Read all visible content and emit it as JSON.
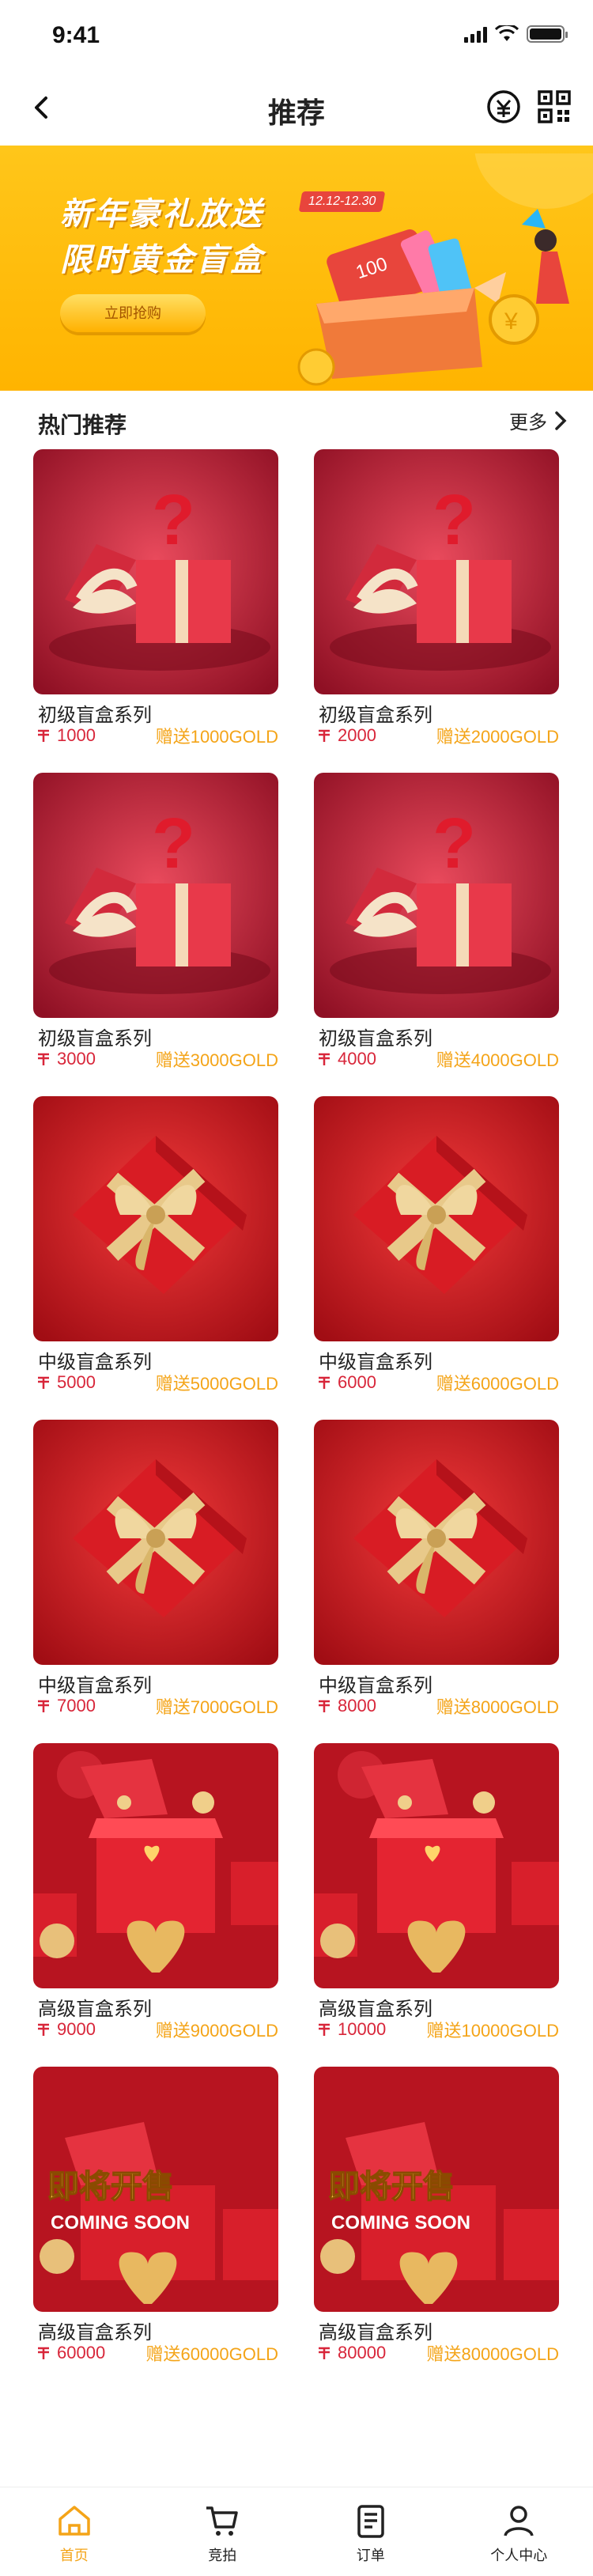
{
  "status": {
    "time": "9:41"
  },
  "nav": {
    "title": "推荐"
  },
  "banner": {
    "line1": "新年豪礼放送",
    "line2": "限时黄金盲盒",
    "date": "12.12-12.30",
    "cta": "立即抢购",
    "card_text": "100"
  },
  "section": {
    "title": "热门推荐",
    "more": "更多"
  },
  "products": [
    {
      "name": "初级盲盒系列",
      "price": "1000",
      "gift": "赠送1000GOLD",
      "image": "red-giftbox-question-mark"
    },
    {
      "name": "初级盲盒系列",
      "price": "2000",
      "gift": "赠送2000GOLD",
      "image": "red-giftbox-question-mark"
    },
    {
      "name": "初级盲盒系列",
      "price": "3000",
      "gift": "赠送3000GOLD",
      "image": "red-giftbox-question-mark"
    },
    {
      "name": "初级盲盒系列",
      "price": "4000",
      "gift": "赠送4000GOLD",
      "image": "red-giftbox-question-mark"
    },
    {
      "name": "中级盲盒系列",
      "price": "5000",
      "gift": "赠送5000GOLD",
      "image": "red-giftbox-gold-ribbon"
    },
    {
      "name": "中级盲盒系列",
      "price": "6000",
      "gift": "赠送6000GOLD",
      "image": "red-giftbox-gold-ribbon"
    },
    {
      "name": "中级盲盒系列",
      "price": "7000",
      "gift": "赠送7000GOLD",
      "image": "red-giftbox-gold-ribbon"
    },
    {
      "name": "中级盲盒系列",
      "price": "8000",
      "gift": "赠送8000GOLD",
      "image": "red-giftbox-gold-ribbon"
    },
    {
      "name": "高级盲盒系列",
      "price": "9000",
      "gift": "赠送9000GOLD",
      "image": "open-giftbox-hearts"
    },
    {
      "name": "高级盲盒系列",
      "price": "10000",
      "gift": "赠送10000GOLD",
      "image": "open-giftbox-hearts"
    },
    {
      "name": "高级盲盒系列",
      "price": "60000",
      "gift": "赠送60000GOLD",
      "image": "coming-soon",
      "promo_line1": "即将开售",
      "promo_line2": "COMING SOON"
    },
    {
      "name": "高级盲盒系列",
      "price": "80000",
      "gift": "赠送80000GOLD",
      "image": "coming-soon",
      "promo_line1": "即将开售",
      "promo_line2": "COMING SOON"
    }
  ],
  "tabs": [
    {
      "label": "首页",
      "icon": "home-icon",
      "active": true
    },
    {
      "label": "竞拍",
      "icon": "cart-icon",
      "active": false
    },
    {
      "label": "订单",
      "icon": "order-icon",
      "active": false
    },
    {
      "label": "个人中心",
      "icon": "user-icon",
      "active": false
    }
  ],
  "colors": {
    "accent": "#f4a418",
    "price": "#d8263a",
    "banner": "#ffb400"
  }
}
